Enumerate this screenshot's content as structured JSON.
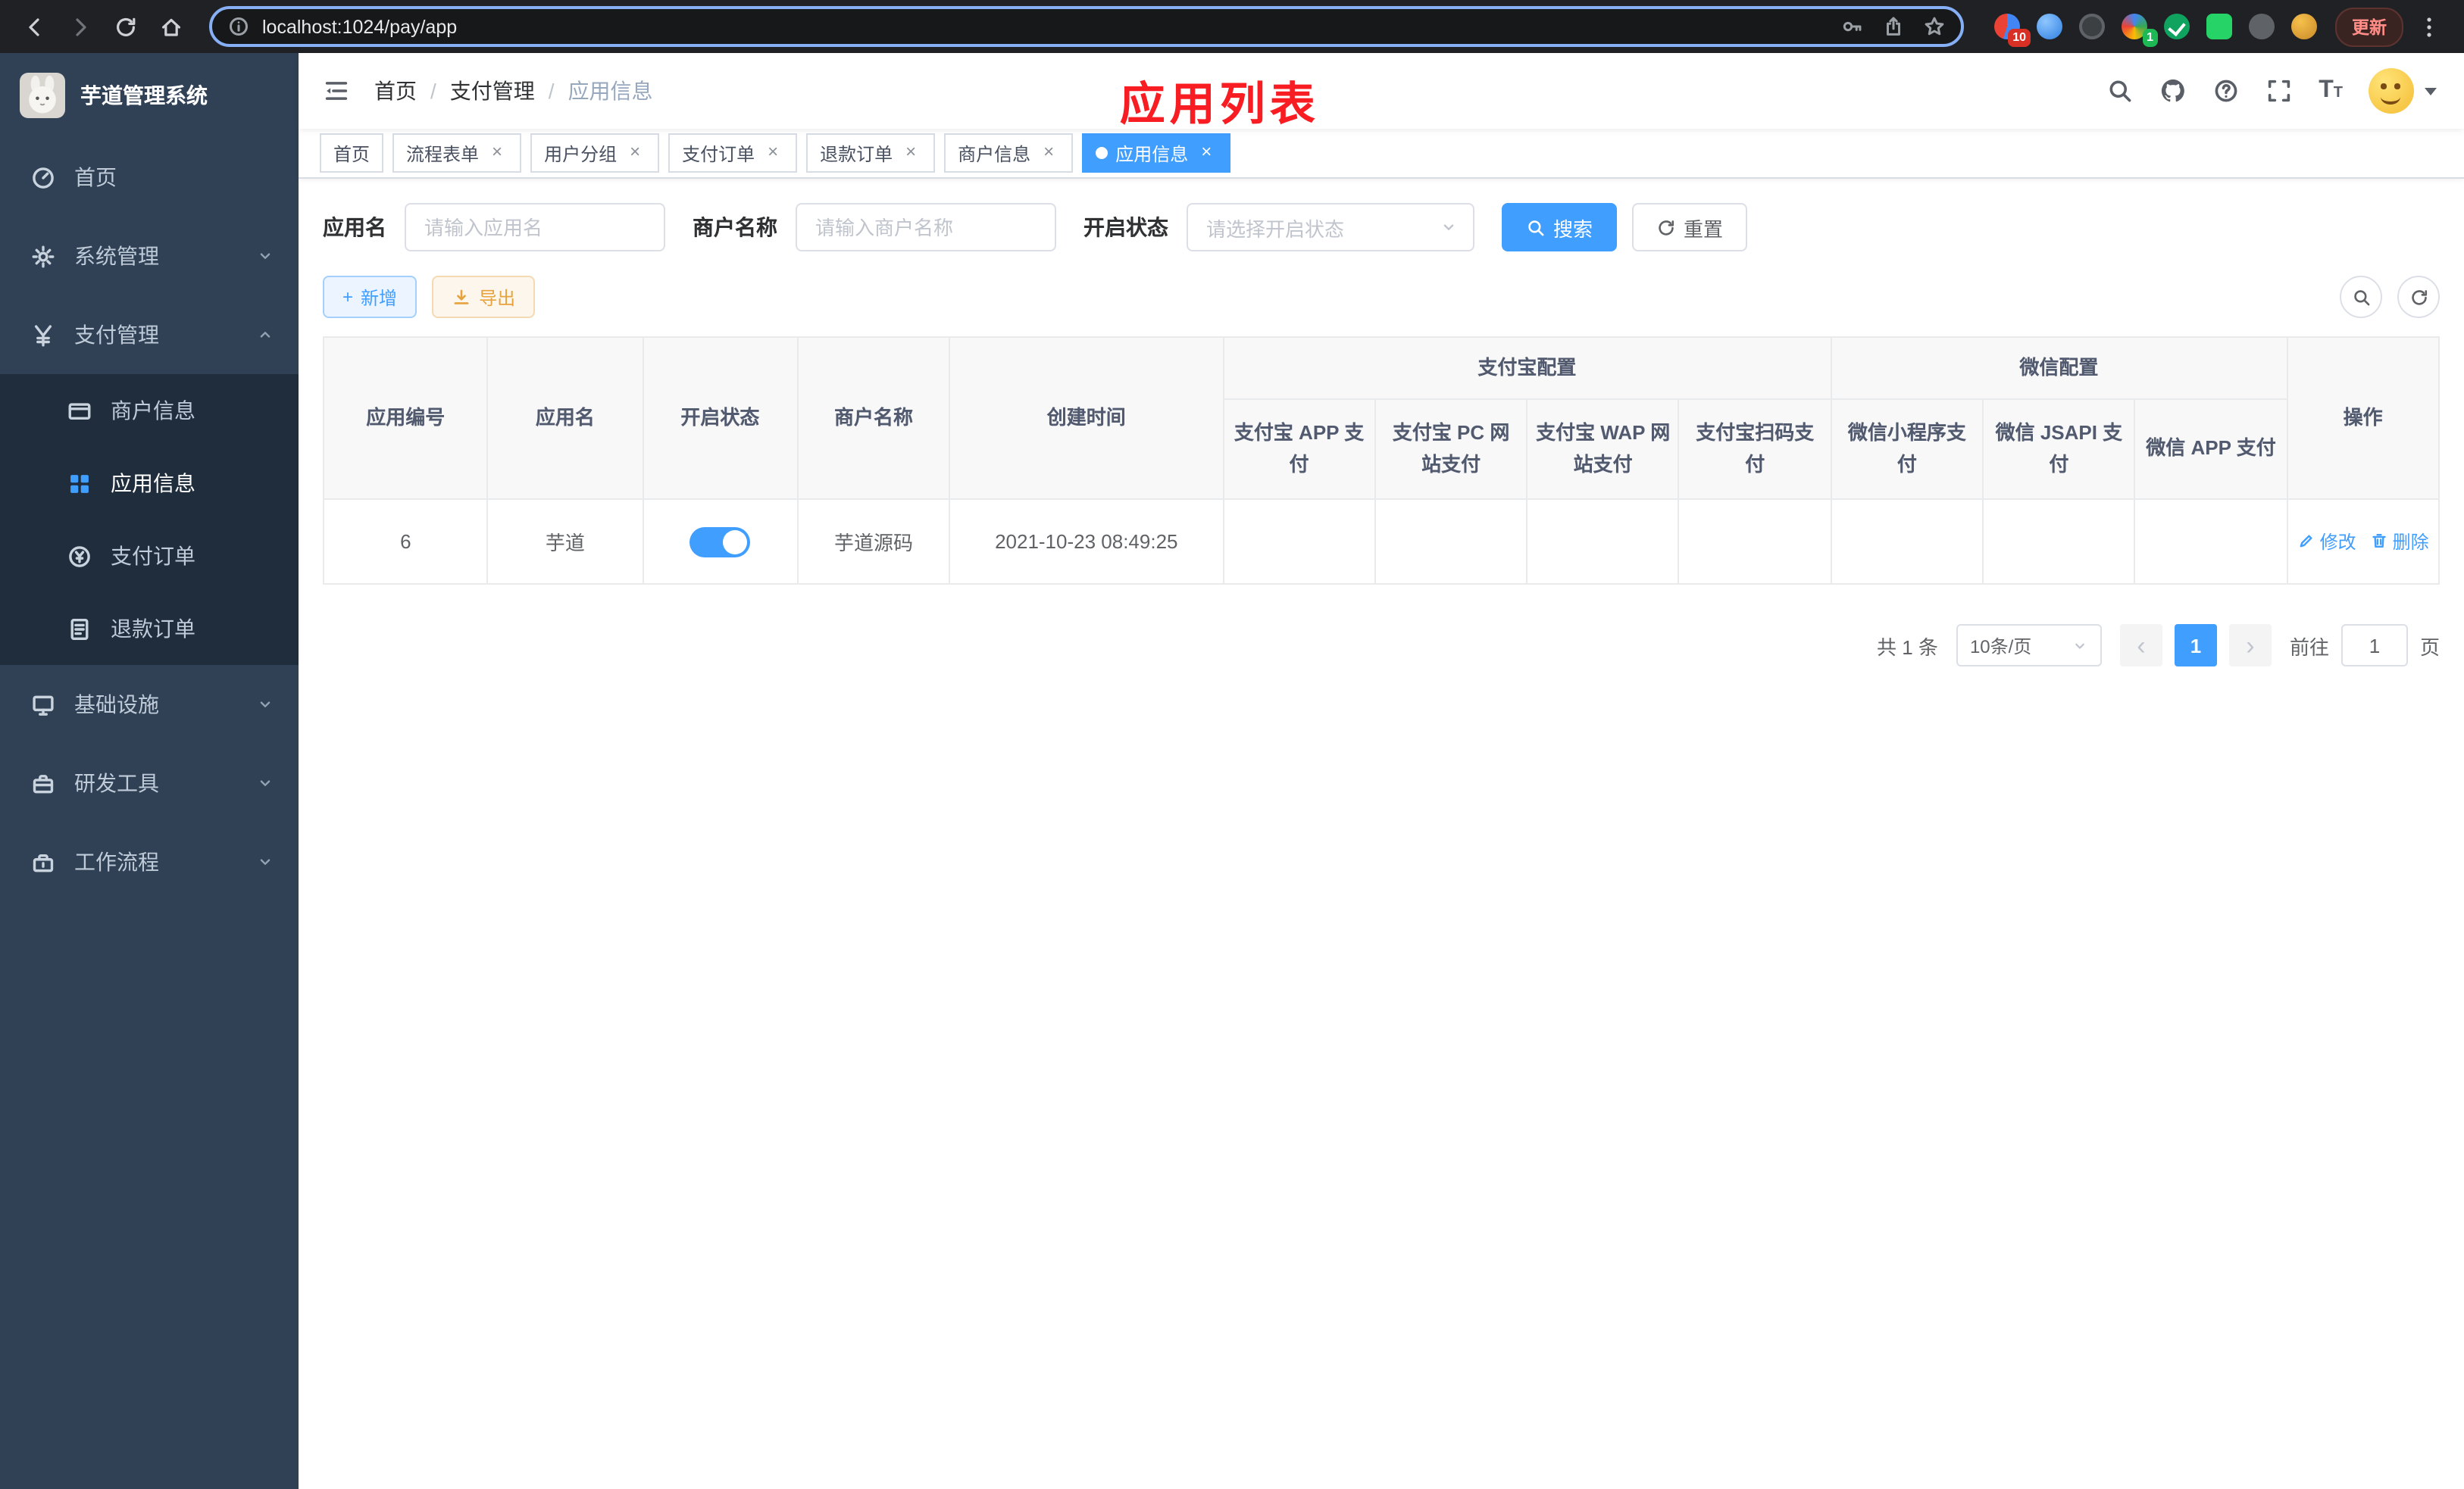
{
  "colors": {
    "primary": "#409EFF",
    "success": "#13ce66",
    "danger": "#ff4949",
    "sidebar_bg": "#304156",
    "submenu_bg": "#1f2d3d",
    "overlay_title_color": "#f81d22"
  },
  "browser": {
    "url": "localhost:1024/pay/app",
    "update_label": "更新",
    "puzzle_badge": "10",
    "colorful_badge": "1"
  },
  "overlay_title": "应用列表",
  "sidebar": {
    "title": "芋道管理系统",
    "home": "首页",
    "system": "系统管理",
    "pay": "支付管理",
    "pay_children": [
      "商户信息",
      "应用信息",
      "支付订单",
      "退款订单"
    ],
    "infra": "基础设施",
    "devtools": "研发工具",
    "workflow": "工作流程"
  },
  "navbar": {
    "breadcrumb": [
      "首页",
      "支付管理",
      "应用信息"
    ]
  },
  "tabs": [
    {
      "label": "首页"
    },
    {
      "label": "流程表单"
    },
    {
      "label": "用户分组"
    },
    {
      "label": "支付订单"
    },
    {
      "label": "退款订单"
    },
    {
      "label": "商户信息"
    },
    {
      "label": "应用信息"
    }
  ],
  "filters": {
    "app_name_label": "应用名",
    "app_name_placeholder": "请输入应用名",
    "merchant_label": "商户名称",
    "merchant_placeholder": "请输入商户名称",
    "status_label": "开启状态",
    "status_placeholder": "请选择开启状态",
    "search_label": "搜索",
    "reset_label": "重置"
  },
  "toolbar": {
    "add_label": "新增",
    "export_label": "导出"
  },
  "table": {
    "group_headers": {
      "alipay": "支付宝配置",
      "wechat": "微信配置"
    },
    "columns": {
      "app_id": "应用编号",
      "app_name": "应用名",
      "status": "开启状态",
      "merchant": "商户名称",
      "created": "创建时间",
      "alipay_app": "支付宝 APP 支付",
      "alipay_pc": "支付宝 PC 网站支付",
      "alipay_wap": "支付宝 WAP 网站支付",
      "alipay_qr": "支付宝扫码支付",
      "wx_mini": "微信小程序支付",
      "wx_jsapi": "微信 JSAPI 支付",
      "wx_app": "微信 APP 支付",
      "actions": "操作"
    },
    "row": {
      "app_id": "6",
      "app_name": "芋道",
      "status_on": true,
      "merchant": "芋道源码",
      "created": "2021-10-23 08:49:25",
      "config_states": [
        false,
        false,
        false,
        false,
        false,
        true,
        false
      ],
      "edit_label": "修改",
      "delete_label": "删除"
    }
  },
  "pagination": {
    "total_text": "共 1 条",
    "page_size": "10条/页",
    "current_page": "1",
    "goto_label": "前往",
    "goto_value": "1",
    "page_suffix": "页"
  }
}
